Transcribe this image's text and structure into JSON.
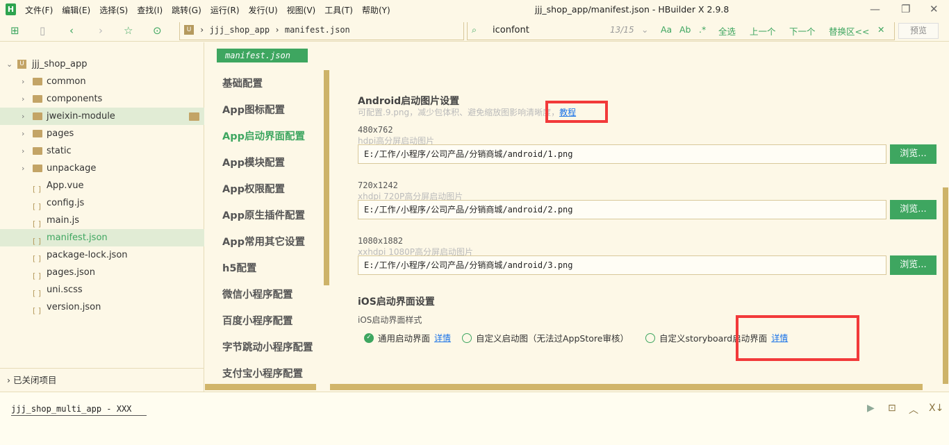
{
  "app": {
    "logo": "H",
    "title": "jjj_shop_app/manifest.json - HBuilder X 2.9.8"
  },
  "menu": [
    "文件(F)",
    "编辑(E)",
    "选择(S)",
    "查找(I)",
    "跳转(G)",
    "运行(R)",
    "发行(U)",
    "视图(V)",
    "工具(T)",
    "帮助(Y)"
  ],
  "breadcrumb": {
    "project": "jjj_shop_app",
    "file": "manifest.json"
  },
  "find": {
    "query": "iconfont",
    "count": "13/15",
    "case": "Aa",
    "word": "Ab",
    "regex": ".*",
    "select_all": "全选",
    "prev": "上一个",
    "next": "下一个",
    "replace": "替换区<<",
    "close": "✕"
  },
  "preview": "预览",
  "sidebar": {
    "project": "jjj_shop_app",
    "items": [
      {
        "label": "common",
        "type": "folder"
      },
      {
        "label": "components",
        "type": "folder"
      },
      {
        "label": "jweixin-module",
        "type": "folder"
      },
      {
        "label": "pages",
        "type": "folder"
      },
      {
        "label": "static",
        "type": "folder"
      },
      {
        "label": "unpackage",
        "type": "folder"
      },
      {
        "label": "App.vue",
        "type": "file"
      },
      {
        "label": "config.js",
        "type": "file"
      },
      {
        "label": "main.js",
        "type": "file"
      },
      {
        "label": "manifest.json",
        "type": "file"
      },
      {
        "label": "package-lock.json",
        "type": "file"
      },
      {
        "label": "pages.json",
        "type": "file"
      },
      {
        "label": "uni.scss",
        "type": "file"
      },
      {
        "label": "version.json",
        "type": "file"
      }
    ],
    "closed": "已关闭项目"
  },
  "editor": {
    "tab": "manifest.json",
    "nav": [
      "基础配置",
      "App图标配置",
      "App启动界面配置",
      "App模块配置",
      "App权限配置",
      "App原生插件配置",
      "App常用其它设置",
      "h5配置",
      "微信小程序配置",
      "百度小程序配置",
      "字节跳动小程序配置",
      "支付宝小程序配置"
    ],
    "android": {
      "title": "Android启动图片设置",
      "hint": "可配置.9.png，减少包体积、避免缩放图影响清晰度，",
      "tutorial": "教程",
      "items": [
        {
          "size": "480x762",
          "desc": "hdpi高分屏启动图片",
          "value": "E:/工作/小程序/公司产品/分销商城/android/1.png"
        },
        {
          "size": "720x1242",
          "desc": "xhdpi 720P高分屏启动图片",
          "value": "E:/工作/小程序/公司产品/分销商城/android/2.png"
        },
        {
          "size": "1080x1882",
          "desc": "xxhdpi 1080P高分屏启动图片",
          "value": "E:/工作/小程序/公司产品/分销商城/android/3.png"
        }
      ],
      "browse": "浏览..."
    },
    "ios": {
      "title": "iOS启动界面设置",
      "style_label": "iOS启动界面样式",
      "opt1": "通用启动界面",
      "opt1_link": "详情",
      "opt2": "自定义启动图（无法过AppStore审核）",
      "opt3": "自定义storyboard启动界面",
      "opt3_link": "详情"
    }
  },
  "terminal": {
    "tab": "jjj_shop_multi_app - XXX"
  },
  "colors": {
    "accent": "#3ea660",
    "background": "#fdf8e7",
    "highlight": "#f23a3a"
  }
}
